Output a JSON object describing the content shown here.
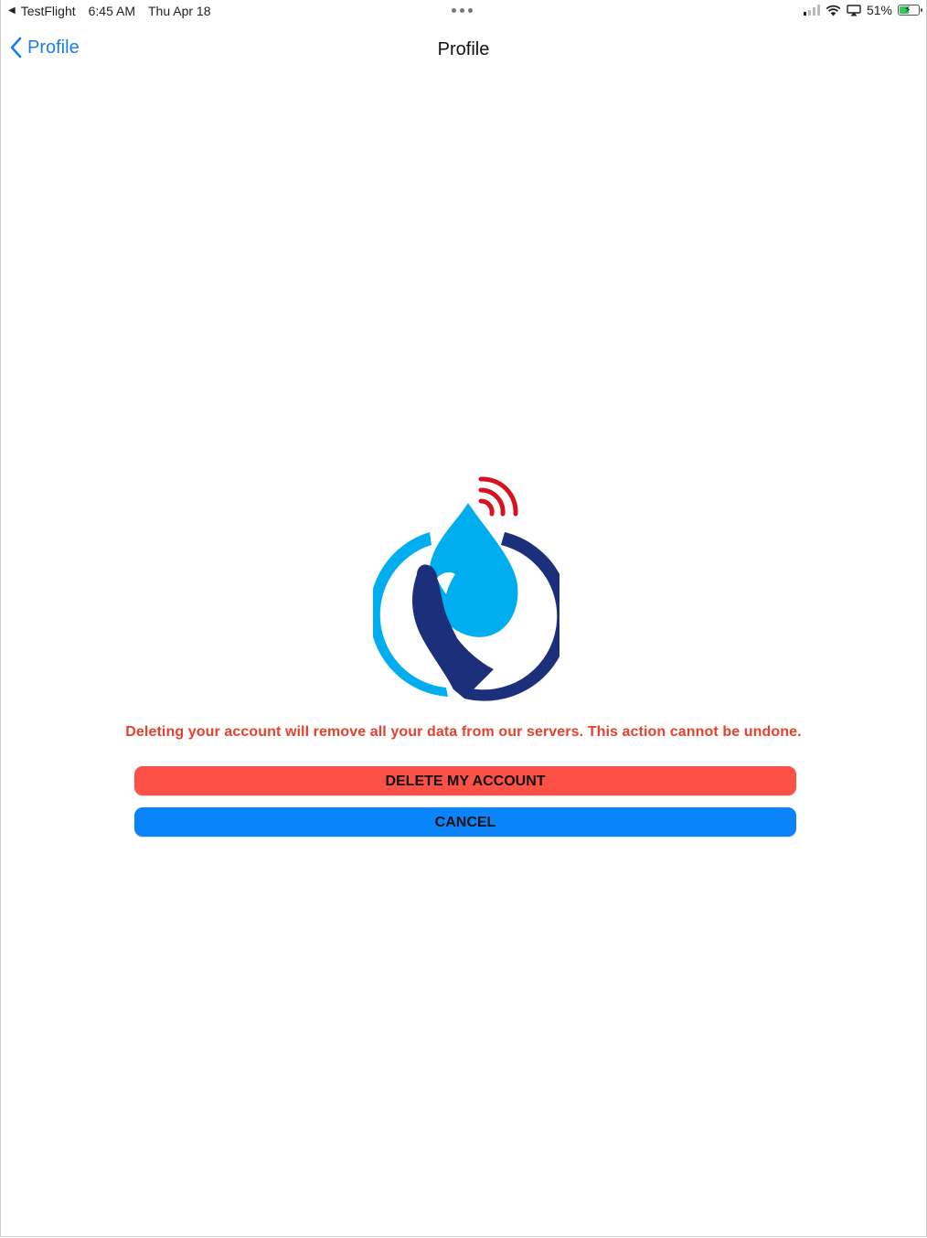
{
  "status_bar": {
    "back_app": "TestFlight",
    "time": "6:45 AM",
    "date": "Thu Apr 18",
    "battery_percent": "51%",
    "battery_level": 0.51,
    "signal_bars_active": 1,
    "signal_bars_total": 4,
    "charging": true
  },
  "nav": {
    "back_label": "Profile",
    "title": "Profile"
  },
  "logo": {
    "colors": {
      "light_blue": "#00aeef",
      "dark_blue": "#1b2f7a",
      "red": "#d7121f"
    }
  },
  "warning": {
    "text": "Deleting your account will remove all your data from our servers. This action cannot be undone.",
    "color": "#e5412d"
  },
  "buttons": {
    "delete_label": "DELETE MY ACCOUNT",
    "delete_color": "#fc5146",
    "cancel_label": "CANCEL",
    "cancel_color": "#0a84fb"
  },
  "icons": {
    "back": "chevron-left-icon",
    "wifi": "wifi-icon",
    "airplay": "airplay-icon",
    "battery": "battery-icon"
  }
}
